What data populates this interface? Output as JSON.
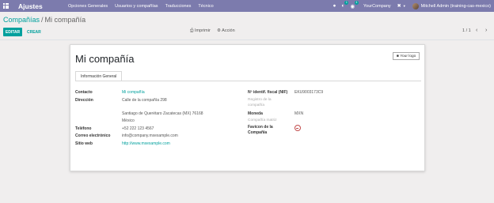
{
  "navbar": {
    "brand": "Ajustes",
    "menu": [
      "Opciones Generales",
      "Usuarios y compañías",
      "Traducciones",
      "Técnico"
    ],
    "chat_badge": "1",
    "activity_badge": "4",
    "company": "YourCompany",
    "user": "Mitchell Admin (training-cas-mexico)"
  },
  "breadcrumb": {
    "parent": "Compañías",
    "separator": "/",
    "current": "Mi compañía"
  },
  "controls": {
    "edit": "EDITAR",
    "create": "CREAR",
    "print": "Imprimir",
    "action": "Acción",
    "pager": "1 / 1"
  },
  "form": {
    "name": "Mi compañía",
    "logo_button": "Your logo",
    "tab": "Información General",
    "left": {
      "contact_label": "Contacto",
      "contact_value": "Mi compañía",
      "address_label": "Dirección",
      "address_line1": "Calle de la compañía 298",
      "address_line2": "Santiago de Querétaro  Zacatecas (MX)  76168",
      "address_country": "México",
      "phone_label": "Teléfono",
      "phone_value": "+52 222 123 4567",
      "email_label": "Correo electrónico",
      "email_value": "info@company.mxexample.com",
      "web_label": "Sitio web",
      "web_value": "http://www.mxexample.com"
    },
    "right": {
      "vat_label": "Nº identif. fiscal (NIF)",
      "vat_value": "EKU9003173C9",
      "registry_label": "Registro de la compañía",
      "currency_label": "Moneda",
      "currency_value": "MXN",
      "parent_label": "Compañía matriz",
      "favicon_label": "Favicon de la Compañía"
    }
  },
  "icons": {
    "apps": "apps-grid-icon",
    "bug": "bug-icon",
    "chat": "chat-icon",
    "activity": "activity-icon",
    "close": "close-icon",
    "print": "print-icon",
    "gear": "gear-icon",
    "camera": "camera-icon"
  },
  "colors": {
    "navbar": "#7c7bad",
    "accent": "#00a09d"
  }
}
